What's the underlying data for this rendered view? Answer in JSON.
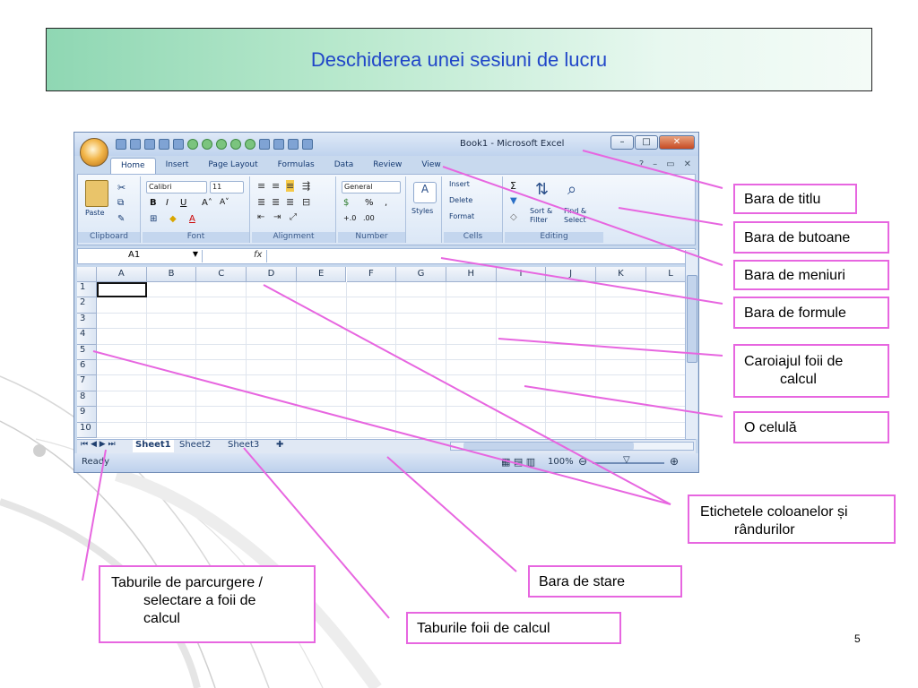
{
  "slide": {
    "title": "Deschiderea unei sesiuni de lucru",
    "page_number": "5",
    "accent_color": "#e766e0",
    "title_color": "#2046c8"
  },
  "excel": {
    "window_title": "Book1 - Microsoft Excel",
    "tabs": [
      "Home",
      "Insert",
      "Page Layout",
      "Formulas",
      "Data",
      "Review",
      "View"
    ],
    "ribbon": {
      "font_name": "Calibri",
      "font_size": "11",
      "number_format": "General",
      "paste_label": "Paste",
      "styles_label": "Styles",
      "insert_label": "Insert",
      "delete_label": "Delete",
      "format_label": "Format",
      "sort_filter_label": "Sort & Filter",
      "find_select_label": "Find & Select",
      "groups": [
        "Clipboard",
        "Font",
        "Alignment",
        "Number",
        "Cells",
        "Editing"
      ]
    },
    "name_box": "A1",
    "fx_label": "fx",
    "columns": [
      "A",
      "B",
      "C",
      "D",
      "E",
      "F",
      "G",
      "H",
      "I",
      "J",
      "K",
      "L"
    ],
    "rows": [
      "1",
      "2",
      "3",
      "4",
      "5",
      "6",
      "7",
      "8",
      "9",
      "10"
    ],
    "sheets": [
      "Sheet1",
      "Sheet2",
      "Sheet3"
    ],
    "status_text": "Ready",
    "zoom": "100%"
  },
  "callouts": [
    {
      "id": "title-bar",
      "lines": [
        "Bara de titlu"
      ]
    },
    {
      "id": "buttons-bar",
      "lines": [
        "Bara de butoane"
      ]
    },
    {
      "id": "menu-bar",
      "lines": [
        "Bara de meniuri"
      ]
    },
    {
      "id": "formula-bar",
      "lines": [
        "Bara de formule"
      ]
    },
    {
      "id": "grid",
      "lines": [
        "Caroiajul foii de",
        "calcul"
      ]
    },
    {
      "id": "cell",
      "lines": [
        "O celulă"
      ]
    },
    {
      "id": "labels",
      "lines": [
        "Etichetele coloanelor și",
        "rândurilor"
      ]
    },
    {
      "id": "status-bar",
      "lines": [
        "Bara de stare"
      ]
    },
    {
      "id": "navigation-tabs",
      "lines": [
        "Taburile de parcurgere /",
        "selectare a foii de",
        "calcul"
      ]
    },
    {
      "id": "sheet-tabs",
      "lines": [
        "Taburile foii de calcul"
      ]
    }
  ]
}
